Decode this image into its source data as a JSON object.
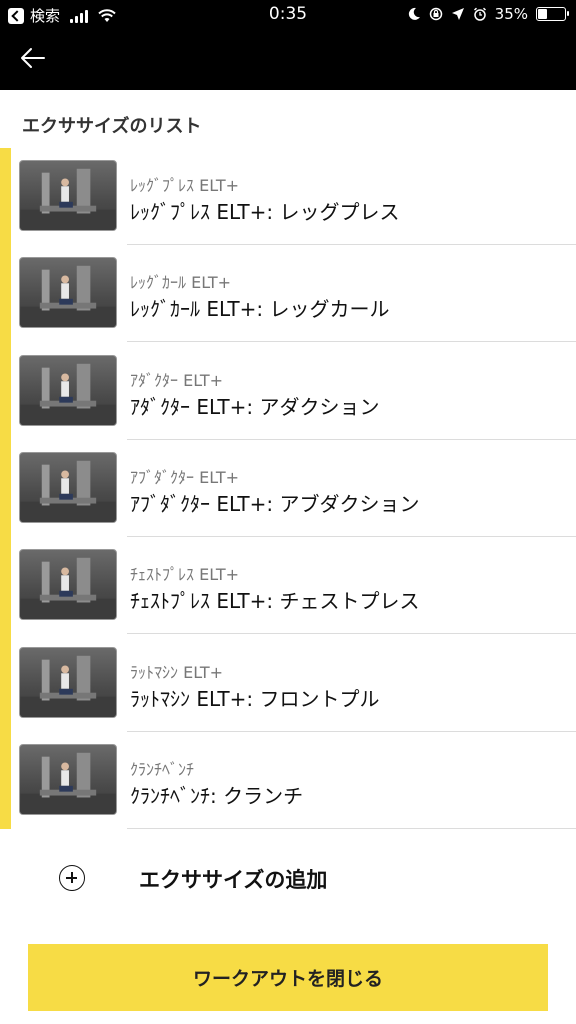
{
  "status_bar": {
    "back_app": "検索",
    "time": "0:35",
    "battery": "35%"
  },
  "section_title": "エクササイズのリスト",
  "exercises": [
    {
      "sub": "ﾚｯｸﾞﾌﾟﾚｽ ELT+",
      "title": "ﾚｯｸﾞﾌﾟﾚｽ ELT+: レッグプレス"
    },
    {
      "sub": "ﾚｯｸﾞｶｰﾙ ELT+",
      "title": "ﾚｯｸﾞｶｰﾙ ELT+: レッグカール"
    },
    {
      "sub": "ｱﾀﾞｸﾀｰ ELT+",
      "title": "ｱﾀﾞｸﾀｰ ELT+: アダクション"
    },
    {
      "sub": "ｱﾌﾞﾀﾞｸﾀｰ ELT+",
      "title": "ｱﾌﾞﾀﾞｸﾀｰ ELT+: アブダクション"
    },
    {
      "sub": "ﾁｪｽﾄﾌﾟﾚｽ ELT+",
      "title": "ﾁｪｽﾄﾌﾟﾚｽ ELT+: チェストプレス"
    },
    {
      "sub": "ﾗｯﾄﾏｼﾝ ELT+",
      "title": "ﾗｯﾄﾏｼﾝ ELT+: フロントプル"
    },
    {
      "sub": "ｸﾗﾝﾁﾍﾞﾝﾁ",
      "title": "ｸﾗﾝﾁﾍﾞﾝﾁ: クランチ"
    }
  ],
  "add_exercise_label": "エクササイズの追加",
  "close_workout_label": "ワークアウトを閉じる",
  "colors": {
    "accent": "#f7dc45",
    "header": "#000000"
  }
}
